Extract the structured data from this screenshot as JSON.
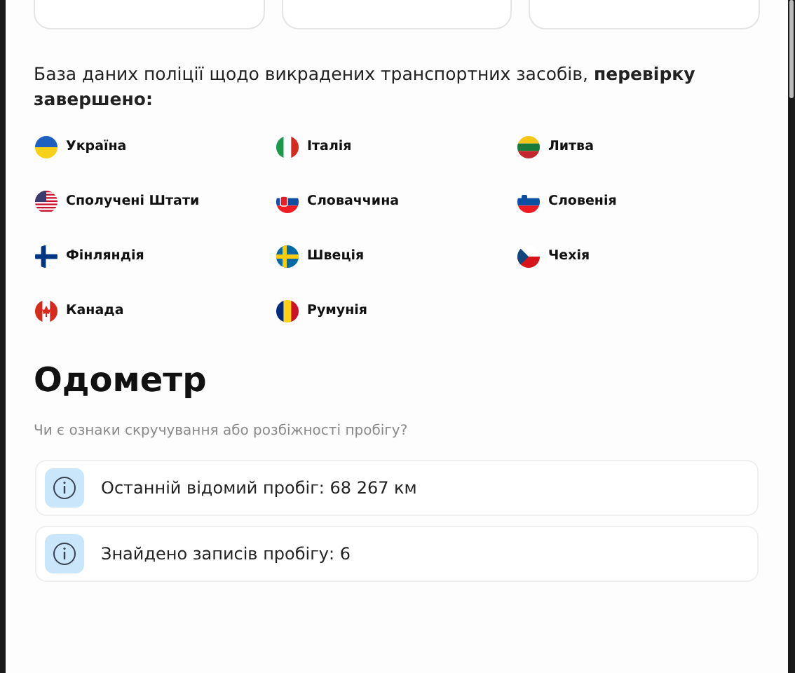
{
  "top_cards": [
    {
      "kind": "card"
    },
    {
      "kind": "card"
    },
    {
      "kind": "card"
    }
  ],
  "stolen_check": {
    "text": "База даних поліції щодо викрадених транспортних засобів, **перевірку завершено:**",
    "countries": [
      {
        "name": "Україна",
        "kind": "ua"
      },
      {
        "name": "Італія",
        "kind": "it"
      },
      {
        "name": "Литва",
        "kind": "lt"
      },
      {
        "name": "Сполучені Штати",
        "kind": "us"
      },
      {
        "name": "Словаччина",
        "kind": "sk"
      },
      {
        "name": "Словенія",
        "kind": "si"
      },
      {
        "name": "Фінляндія",
        "kind": "fi"
      },
      {
        "name": "Швеція",
        "kind": "se"
      },
      {
        "name": "Чехія",
        "kind": "cz"
      },
      {
        "name": "Канада",
        "kind": "ca"
      },
      {
        "name": "Румунія",
        "kind": "ro"
      }
    ]
  },
  "odometer": {
    "title": "Одометр",
    "subtitle": "Чи є ознаки скручування або розбіжності пробігу?",
    "items": [
      {
        "text": "Останній відомий пробіг: 68 267 км"
      },
      {
        "text": "Знайдено записів пробігу: 6"
      }
    ]
  }
}
